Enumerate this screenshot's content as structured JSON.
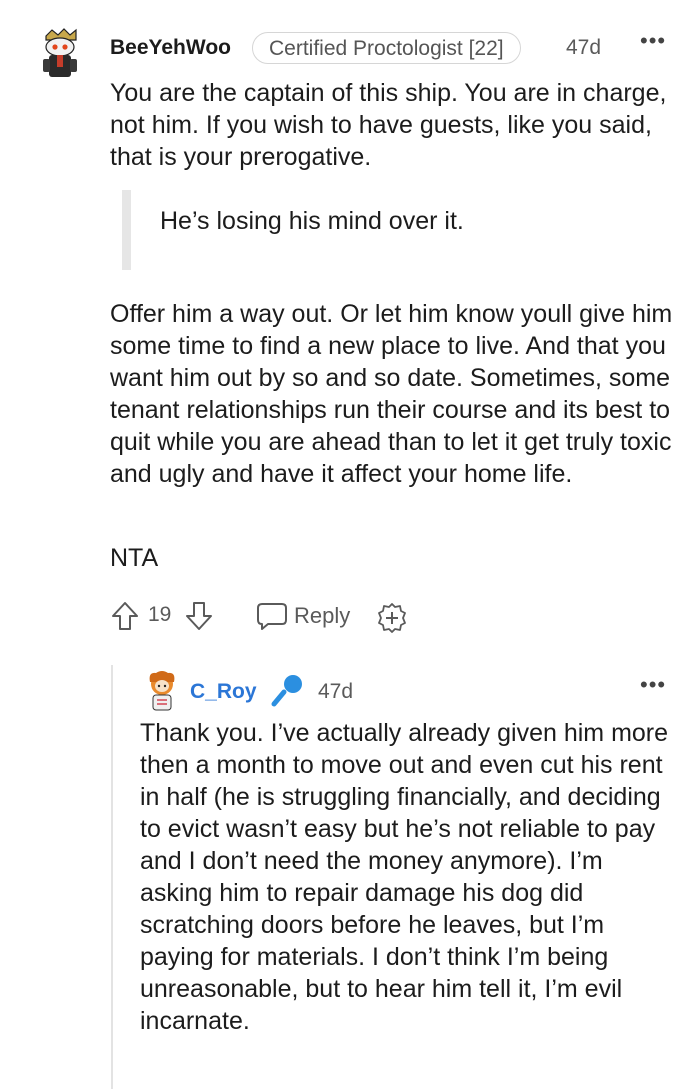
{
  "comment": {
    "username": "BeeYehWoo",
    "flair": "Certified Proctologist [22]",
    "age": "47d",
    "more": "•••",
    "paragraph_1": "You are the captain of this ship. You are in charge, not him. If you wish to have guests, like you said, that is your prerogative.",
    "quote": "He’s losing his mind over it.",
    "paragraph_2": "Offer him a way out. Or let him know youll give him some time to find a new place to live. And that you want him out by so and so date. Sometimes, some tenant relationships run their course and its best to quit while you are ahead than to let it get truly toxic and ugly and have it affect your home life.",
    "paragraph_3": "NTA",
    "vote_count": "19",
    "reply_label": "Reply"
  },
  "reply": {
    "username": "C_Roy",
    "age": "47d",
    "more": "•••",
    "body": "Thank you. I’ve actually already given him more then a month to move out and even cut his rent in half (he is struggling financially, and deciding to evict wasn’t easy but he’s not reliable to pay and I don’t need the money anymore). I’m asking him to repair damage his dog did scratching doors before he leaves, but I’m paying for materials. I don’t think I’m being unreasonable, but to hear him tell it, I’m evil incarnate."
  },
  "icons": {
    "upvote": "upvote-arrow-icon",
    "downvote": "downvote-arrow-icon",
    "reply": "speech-bubble-icon",
    "award": "award-plus-icon",
    "mic": "microphone-icon"
  },
  "colors": {
    "op_username": "#2b76d6",
    "mic": "#2b8fe0"
  }
}
